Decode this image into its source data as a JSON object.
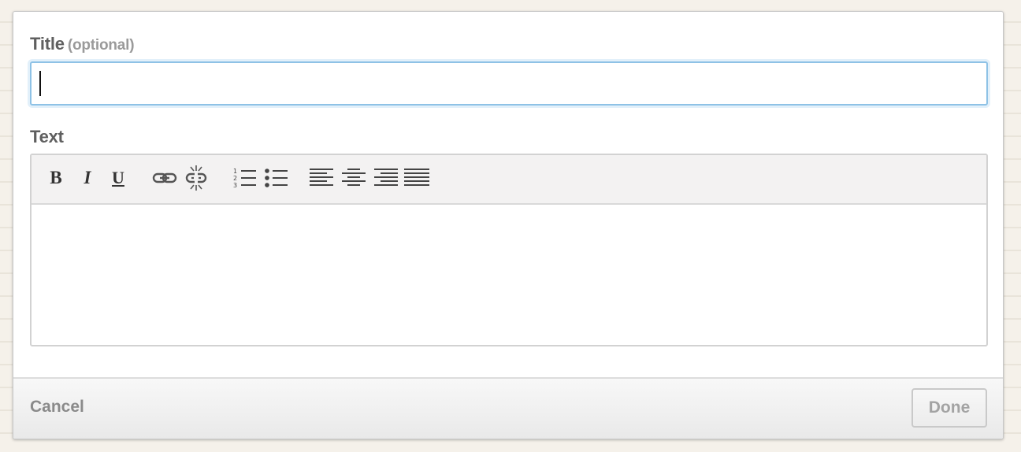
{
  "form": {
    "title_label": "Title",
    "title_optional": "(optional)",
    "title_value": "",
    "text_label": "Text",
    "text_value": ""
  },
  "toolbar": {
    "bold": "B",
    "italic": "I",
    "underline": "U",
    "icons": [
      "link-icon",
      "unlink-icon",
      "ordered-list-icon",
      "unordered-list-icon",
      "align-left-icon",
      "align-center-icon",
      "align-right-icon",
      "align-justify-icon"
    ]
  },
  "footer": {
    "cancel_label": "Cancel",
    "done_label": "Done"
  },
  "colors": {
    "focus_border": "#8ec2e6",
    "label": "#5f5f5f",
    "disabled_text": "#a3a3a3"
  }
}
